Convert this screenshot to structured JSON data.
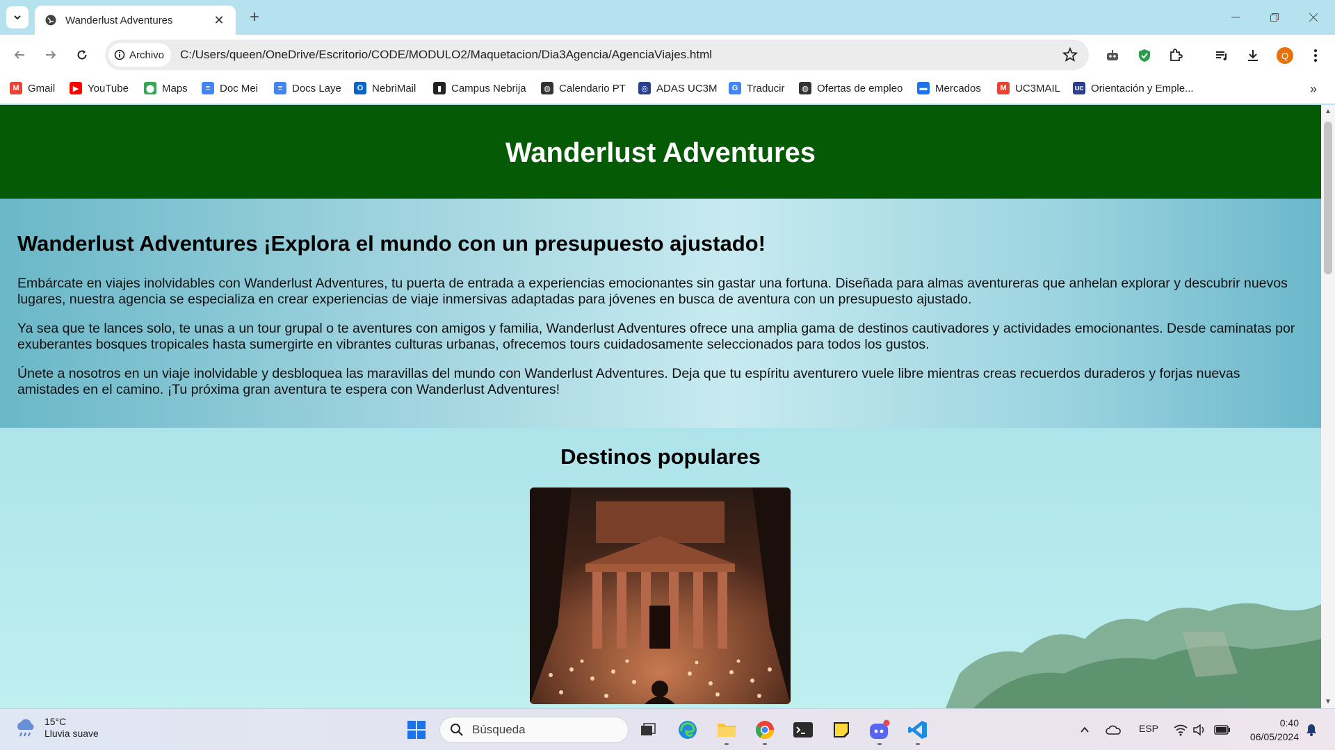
{
  "browser": {
    "tab": {
      "title": "Wanderlust Adventures",
      "close": "✕"
    },
    "new_tab": "+",
    "omnibox": {
      "chip_label": "Archivo",
      "url": "C:/Users/queen/OneDrive/Escritorio/CODE/MODULO2/Maquetacion/Dia3Agencia/AgenciaViajes.html"
    },
    "profile_initial": "Q",
    "bookmarks": [
      {
        "label": "Gmail",
        "icon": "gmail-icon",
        "color": "#ea4335",
        "glyph": "M"
      },
      {
        "label": "YouTube",
        "icon": "youtube-icon",
        "color": "#ff0000",
        "glyph": "▶"
      },
      {
        "label": "Maps",
        "icon": "maps-icon",
        "color": "#34a853",
        "glyph": "⬤"
      },
      {
        "label": "Doc Mei",
        "icon": "docs-icon",
        "color": "#4285f4",
        "glyph": "≡"
      },
      {
        "label": "Docs Laye",
        "icon": "docs-icon",
        "color": "#4285f4",
        "glyph": "≡"
      },
      {
        "label": "NebriMail",
        "icon": "outlook-icon",
        "color": "#0a64c8",
        "glyph": "O"
      },
      {
        "label": "Campus Nebrija",
        "icon": "campus-icon",
        "color": "#222222",
        "glyph": "▮"
      },
      {
        "label": "Calendario PT",
        "icon": "globe-icon",
        "color": "#333333",
        "glyph": "◍"
      },
      {
        "label": "ADAS UC3M",
        "icon": "adas-icon",
        "color": "#2a3f8f",
        "glyph": "◎"
      },
      {
        "label": "Traducir",
        "icon": "translate-icon",
        "color": "#4285f4",
        "glyph": "G"
      },
      {
        "label": "Ofertas de empleo",
        "icon": "globe-icon",
        "color": "#333333",
        "glyph": "◍"
      },
      {
        "label": "Mercados",
        "icon": "mercados-icon",
        "color": "#1a73e8",
        "glyph": "▬"
      },
      {
        "label": "UC3MAIL",
        "icon": "gmail-icon",
        "color": "#ea4335",
        "glyph": "M"
      },
      {
        "label": "Orientación y Emple...",
        "icon": "uc3m-icon",
        "color": "#2a3f8f",
        "glyph": "uc"
      }
    ],
    "bookmarks_more": "»"
  },
  "page": {
    "header_title": "Wanderlust Adventures",
    "hero": {
      "heading": "Wanderlust Adventures ¡Explora el mundo con un presupuesto ajustado!",
      "paragraphs": [
        "Embárcate en viajes inolvidables con Wanderlust Adventures, tu puerta de entrada a experiencias emocionantes sin gastar una fortuna. Diseñada para almas aventureras que anhelan explorar y descubrir nuevos lugares, nuestra agencia se especializa en crear experiencias de viaje inmersivas adaptadas para jóvenes en busca de aventura con un presupuesto ajustado.",
        "Ya sea que te lances solo, te unas a un tour grupal o te aventures con amigos y familia, Wanderlust Adventures ofrece una amplia gama de destinos cautivadores y actividades emocionantes. Desde caminatas por exuberantes bosques tropicales hasta sumergirte en vibrantes culturas urbanas, ofrecemos tours cuidadosamente seleccionados para todos los gustos.",
        "Únete a nosotros en un viaje inolvidable y desbloquea las maravillas del mundo con Wanderlust Adventures. Deja que tu espíritu aventurero vuele libre mientras creas recuerdos duraderos y forjas nuevas amistades en el camino. ¡Tu próxima gran aventura te espera con Wanderlust Adventures!"
      ]
    },
    "destinations_heading": "Destinos populares"
  },
  "taskbar": {
    "weather": {
      "temp": "15°C",
      "desc": "Lluvia suave"
    },
    "search_placeholder": "Búsqueda",
    "language": "ESP",
    "time": "0:40",
    "date": "06/05/2024"
  }
}
